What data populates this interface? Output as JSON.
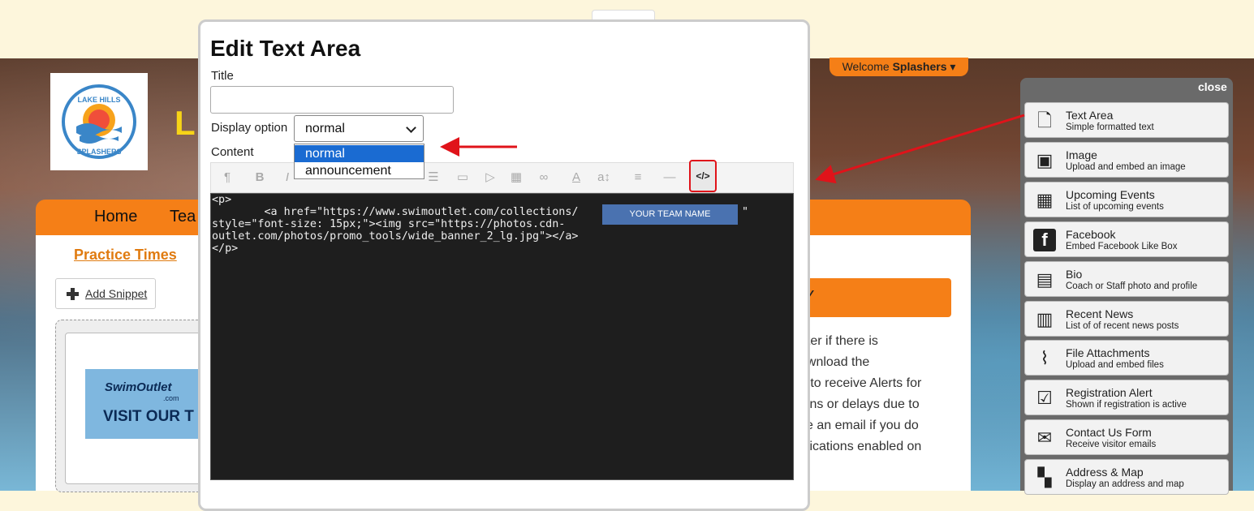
{
  "header": {
    "welcome_prefix": "Welcome",
    "welcome_user": "Splashers",
    "site_title_initial": "L"
  },
  "logo": {
    "text": "LAKE HILLS SPLASHERS"
  },
  "nav": {
    "items": [
      "Home",
      "Tea"
    ]
  },
  "page": {
    "practice_link": "Practice Times",
    "add_snippet": "Add Snippet",
    "banner_brand": "SwimOutlet",
    "banner_sub": ".com",
    "banner_cta": "VISIT OUR T",
    "orange_bar_text": "Y",
    "body_lines": [
      "ater if there is",
      "ownload the",
      "o to receive Alerts for",
      "ions or delays due to",
      "ve an email if you do",
      "tifications enabled on"
    ]
  },
  "dialog": {
    "title": "Edit Text Area",
    "title_label": "Title",
    "title_value": "",
    "display_label": "Display option",
    "display_value": "normal",
    "display_options": [
      "normal",
      "announcement"
    ],
    "content_label": "Content",
    "toolbar": {
      "paragraph": "¶",
      "bold": "B",
      "italic": "I",
      "text_color": "A",
      "font_size": "a↕",
      "hr": "—",
      "code": "</>"
    },
    "code_lines": [
      "<p>",
      "        <a href=\"https://www.swimoutlet.com/collections/                         \"",
      "style=\"font-size: 15px;\"><img src=\"https://photos.cdn-",
      "outlet.com/photos/promo_tools/wide_banner_2_lg.jpg\"></a>",
      "</p>"
    ],
    "team_name_overlay": "YOUR TEAM NAME"
  },
  "panel": {
    "close_label": "close",
    "items": [
      {
        "title": "Text Area",
        "desc": "Simple formatted text",
        "icon": "document-icon"
      },
      {
        "title": "Image",
        "desc": "Upload and embed an image",
        "icon": "image-icon"
      },
      {
        "title": "Upcoming Events",
        "desc": "List of upcoming events",
        "icon": "calendar-icon"
      },
      {
        "title": "Facebook",
        "desc": "Embed Facebook Like Box",
        "icon": "facebook-icon"
      },
      {
        "title": "Bio",
        "desc": "Coach or Staff photo and profile",
        "icon": "bio-icon"
      },
      {
        "title": "Recent News",
        "desc": "List of of recent news posts",
        "icon": "news-icon"
      },
      {
        "title": "File Attachments",
        "desc": "Upload and embed files",
        "icon": "paperclip-icon"
      },
      {
        "title": "Registration Alert",
        "desc": "Shown if registration is active",
        "icon": "clipboard-check-icon"
      },
      {
        "title": "Contact Us Form",
        "desc": "Receive visitor emails",
        "icon": "envelope-icon"
      },
      {
        "title": "Address & Map",
        "desc": "Display an address and map",
        "icon": "map-icon"
      }
    ]
  },
  "colors": {
    "accent_orange": "#f57f17",
    "annotation_red": "#e0131a",
    "selection_blue": "#1a6bd2"
  }
}
